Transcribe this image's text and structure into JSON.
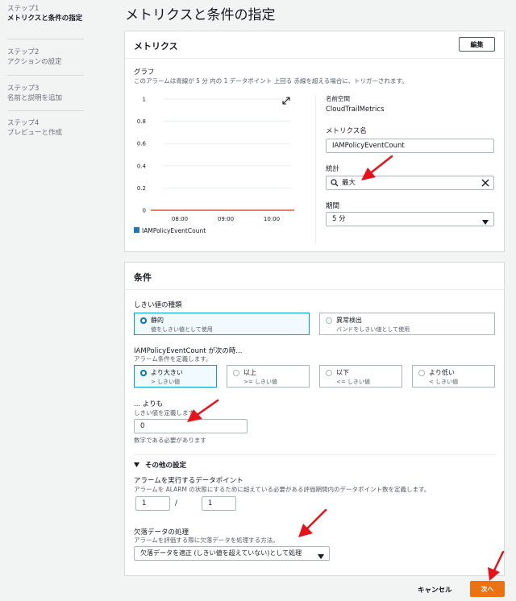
{
  "sidebar": {
    "steps": [
      {
        "num": "ステップ1",
        "label": "メトリクスと条件の指定",
        "label2": "定"
      },
      {
        "num": "ステップ2",
        "label": "アクションの設定"
      },
      {
        "num": "ステップ3",
        "label": "名前と説明を追加"
      },
      {
        "num": "ステップ4",
        "label": "プレビューと作成"
      }
    ]
  },
  "page_title": "メトリクスと条件の指定",
  "metrics": {
    "title": "メトリクス",
    "edit_label": "編集",
    "graph_label": "グラフ",
    "graph_desc": "このアラームは青線が 5 分 内の 1 データポイント 上回る 赤線を超える場合に、トリガーされます。",
    "namespace_label": "名前空間",
    "namespace_value": "CloudTrailMetrics",
    "metric_name_label": "メトリクス名",
    "metric_name_value": "IAMPolicyEventCount",
    "statistic_label": "統計",
    "statistic_value": "最大",
    "period_label": "期間",
    "period_value": "5 分"
  },
  "chart_data": {
    "type": "line",
    "ylim": [
      0,
      1
    ],
    "yticks": [
      "1",
      "0.8",
      "0.6",
      "0.4",
      "0.2",
      "0"
    ],
    "xticks": [
      "08:00",
      "09:00",
      "10:00"
    ],
    "series": [
      {
        "name": "IAMPolicyEventCount",
        "color": "#1f77b4",
        "values": []
      }
    ],
    "threshold": {
      "value": 0,
      "color": "#d13212"
    }
  },
  "conditions": {
    "title": "条件",
    "threshold_type_label": "しきい値の種類",
    "static_title": "静的",
    "static_desc": "値をしきい値として使用",
    "anomaly_title": "異常検出",
    "anomaly_desc": "バンドをしきい値として使用",
    "when_label": "IAMPolicyEventCount が次の時...",
    "when_desc": "アラーム条件を定義します。",
    "op_greater_title": "より大きい",
    "op_greater_desc": "> しきい値",
    "op_gte_title": "以上",
    "op_gte_desc": ">= しきい値",
    "op_lte_title": "以下",
    "op_lte_desc": "<= しきい値",
    "op_less_title": "より低い",
    "op_less_desc": "< しきい値",
    "than_label": "... よりも",
    "than_desc": "しきい値を定義します。",
    "threshold_value": "0",
    "threshold_hint": "数字である必要があります",
    "other_settings": "その他の設定",
    "datapoints_label": "アラームを実行するデータポイント",
    "datapoints_desc": "アラームを ALARM の状態にするために超えている必要がある評価期間内のデータポイント数を定義します。",
    "dp_value1": "1",
    "dp_sep": "/",
    "dp_value2": "1",
    "missing_label": "欠落データの処理",
    "missing_desc": "アラームを評価する際に欠落データを処理する方法。",
    "missing_value": "欠落データを適正 (しきい値を超えていない)として処理"
  },
  "footer": {
    "cancel": "キャンセル",
    "next": "次へ"
  },
  "colors": {
    "accent": "#0073bb",
    "next": "#ec7211",
    "annotation_arrow": "#e8121b"
  }
}
